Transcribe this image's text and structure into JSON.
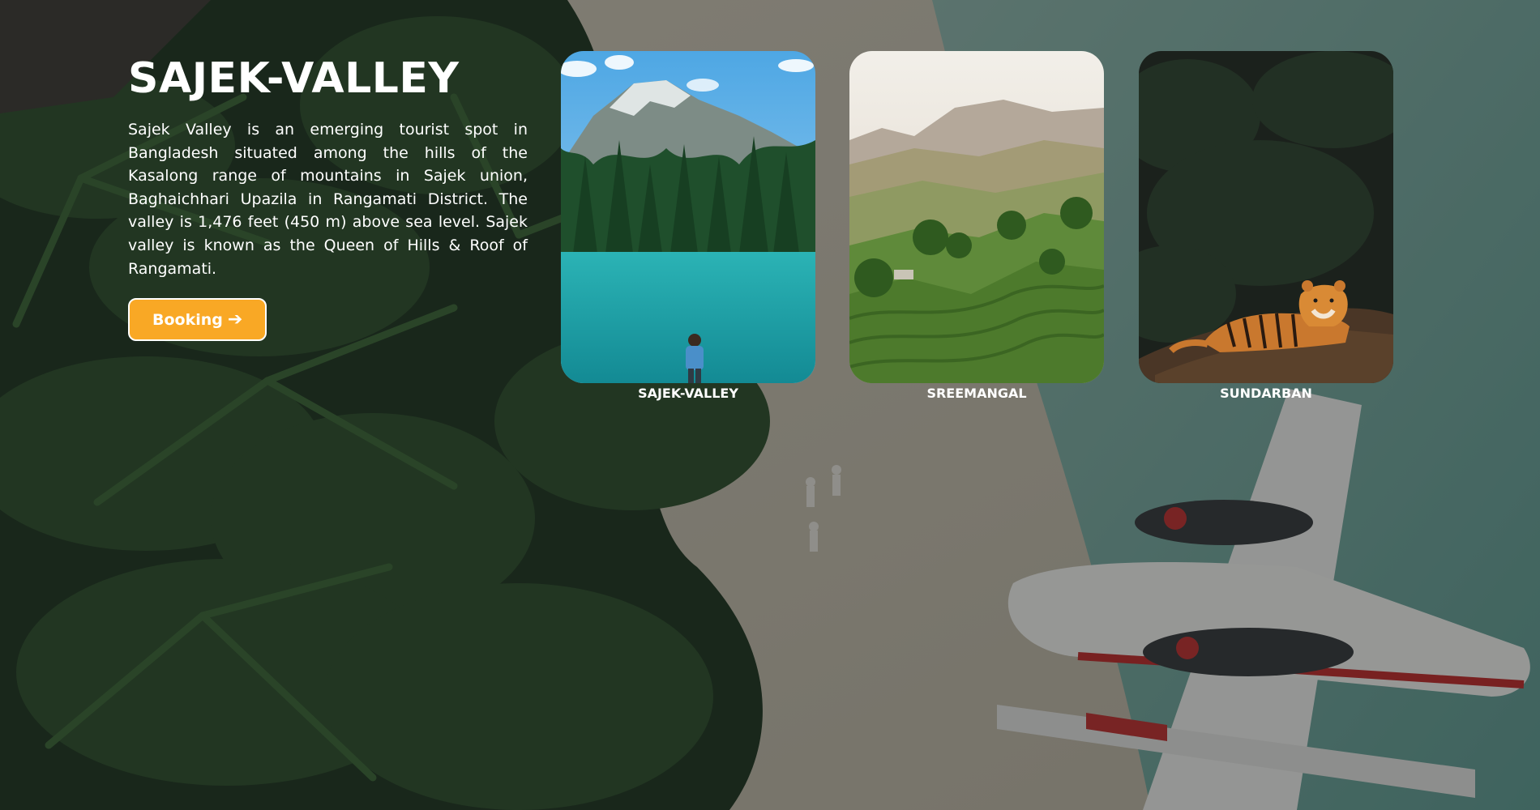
{
  "hero": {
    "title": "SAJEK-VALLEY",
    "description": "Sajek Valley is an emerging tourist spot in Bangladesh situated among the hills of the Kasalong range of mountains in Sajek union, Baghaichhari Upazila in Rangamati District. The valley is 1,476 feet (450 m) above sea level. Sajek valley is known as the Queen of Hills & Roof of Rangamati.",
    "booking_label": "Booking",
    "booking_icon": "arrow-right-icon"
  },
  "cards": [
    {
      "label": "SAJEK-VALLEY",
      "image": "mountain-lake-hiker-image"
    },
    {
      "label": "SREEMANGAL",
      "image": "tea-garden-hills-image"
    },
    {
      "label": "SUNDARBAN",
      "image": "tiger-forest-image"
    }
  ],
  "colors": {
    "accent": "#f9a825",
    "text": "#ffffff",
    "overlay": "#141616"
  }
}
